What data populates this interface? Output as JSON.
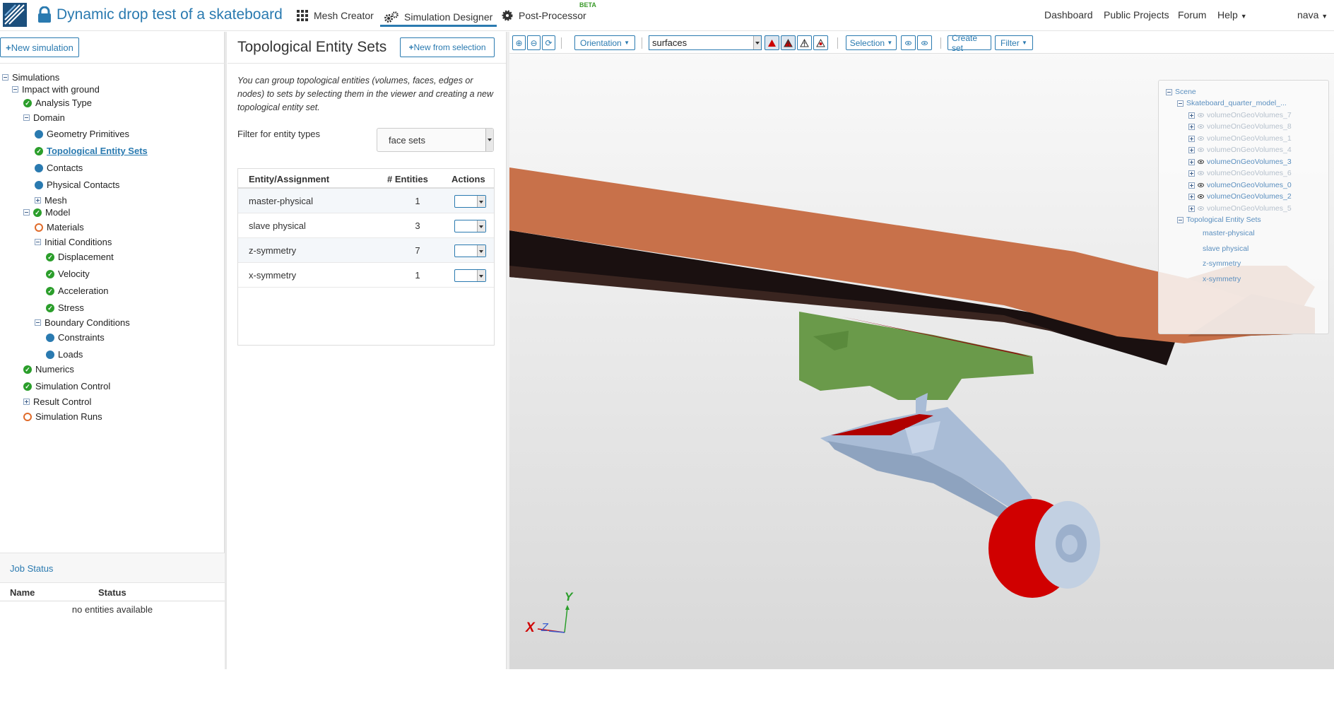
{
  "app": {
    "title": "Dynamic drop test of a skateboard",
    "nav": {
      "mesh_creator": "Mesh Creator",
      "simulation_designer": "Simulation Designer",
      "post_processor": "Post-Processor",
      "beta": "BETA"
    },
    "right_nav": {
      "dashboard": "Dashboard",
      "public_projects": "Public Projects",
      "forum": "Forum",
      "help": "Help",
      "user": "nava"
    }
  },
  "sidebar": {
    "new_simulation": "New simulation",
    "tree": {
      "simulations": "Simulations",
      "impact": "Impact with ground",
      "analysis_type": "Analysis Type",
      "domain": "Domain",
      "geometry_primitives": "Geometry Primitives",
      "topological_entity_sets": "Topological Entity Sets",
      "contacts": "Contacts",
      "physical_contacts": "Physical Contacts",
      "mesh": "Mesh",
      "model": "Model",
      "materials": "Materials",
      "initial_conditions": "Initial Conditions",
      "displacement": "Displacement",
      "velocity": "Velocity",
      "acceleration": "Acceleration",
      "stress": "Stress",
      "boundary_conditions": "Boundary Conditions",
      "constraints": "Constraints",
      "loads": "Loads",
      "numerics": "Numerics",
      "simulation_control": "Simulation Control",
      "result_control": "Result Control",
      "simulation_runs": "Simulation Runs"
    },
    "job_status": {
      "title": "Job Status",
      "col_name": "Name",
      "col_status": "Status",
      "empty": "no entities available"
    }
  },
  "panel": {
    "title": "Topological Entity Sets",
    "new_from_selection": "New from selection",
    "help": "You can group topological entities (volumes, faces, edges or nodes) to sets by selecting them in the viewer and creating a new topological entity set.",
    "filter_label": "Filter for entity types",
    "filter_value": "face sets",
    "table": {
      "headers": {
        "entity": "Entity/Assignment",
        "count": "# Entities",
        "actions": "Actions"
      },
      "rows": [
        {
          "name": "master-physical",
          "count": "1"
        },
        {
          "name": "slave physical",
          "count": "3"
        },
        {
          "name": "z-symmetry",
          "count": "7"
        },
        {
          "name": "x-symmetry",
          "count": "1"
        }
      ]
    }
  },
  "viewer": {
    "toolbar": {
      "orientation": "Orientation",
      "render_mode": "surfaces",
      "selection": "Selection",
      "create_set": "Create set",
      "filter": "Filter"
    },
    "scene_tree": {
      "scene": "Scene",
      "model": "Skateboard_quarter_model_...",
      "volumes": [
        {
          "name": "volumeOnGeoVolumes_7",
          "visible": false
        },
        {
          "name": "volumeOnGeoVolumes_8",
          "visible": false
        },
        {
          "name": "volumeOnGeoVolumes_1",
          "visible": false
        },
        {
          "name": "volumeOnGeoVolumes_4",
          "visible": false
        },
        {
          "name": "volumeOnGeoVolumes_3",
          "visible": true
        },
        {
          "name": "volumeOnGeoVolumes_6",
          "visible": false
        },
        {
          "name": "volumeOnGeoVolumes_0",
          "visible": true
        },
        {
          "name": "volumeOnGeoVolumes_2",
          "visible": true
        },
        {
          "name": "volumeOnGeoVolumes_5",
          "visible": false
        }
      ],
      "tes_group": "Topological Entity Sets",
      "tes_items": [
        "master-physical",
        "slave physical",
        "z-symmetry",
        "x-symmetry"
      ]
    },
    "axes": {
      "x": "X",
      "y": "Y",
      "z": "Z"
    }
  },
  "colors": {
    "accent": "#2a7ab0",
    "ok": "#2b9e2b",
    "board": "#c8714a",
    "truck_base": "#6a9a4a",
    "wheel": "#d00000",
    "truck": "#a9bcd6"
  }
}
